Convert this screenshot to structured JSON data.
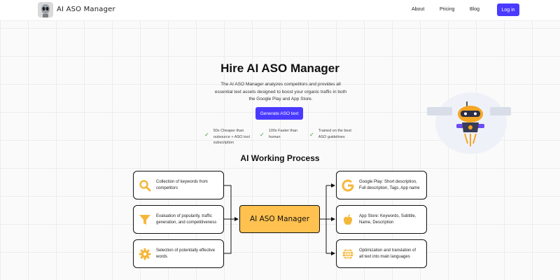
{
  "header": {
    "logo_text": "AI ASO Manager",
    "nav": [
      "About",
      "Pricing",
      "Blog"
    ],
    "login_label": "Log in"
  },
  "hero": {
    "title": "Hire AI ASO Manager",
    "description": "The AI ASO Manager analyzes competitors and provides all essential text assets designed to boost your organic traffic in both the Google Play and App Store.",
    "cta_label": "Generate ASO text",
    "features": [
      {
        "line1": "50x Cheaper than",
        "line2": "outsource + ASO tool",
        "line3": "subscription"
      },
      {
        "line1": "100x Faster than",
        "line2": "human",
        "line3": ""
      },
      {
        "line1": "Trained on the best",
        "line2": "ASO guidelines",
        "line3": ""
      }
    ]
  },
  "process": {
    "title": "AI Working Process",
    "center_label": "AI ASO Manager",
    "inputs": [
      {
        "icon": "search-icon",
        "line1": "Collection of keywords from",
        "line2": "competitors",
        "line3": ""
      },
      {
        "icon": "funnel-icon",
        "line1": "Evaluation of popularity, traffic",
        "line2": "generation, and competitiveness",
        "line3": ""
      },
      {
        "icon": "gear-icon",
        "line1": "Selection of potentially effective",
        "line2": "words",
        "line3": ""
      }
    ],
    "outputs": [
      {
        "icon": "google-icon",
        "line1": "Google Play: Short description,",
        "line2": "Full description, Tags, App name"
      },
      {
        "icon": "apple-icon",
        "line1": "App Store: Keywords, Subtitle,",
        "line2": "Name, Description"
      },
      {
        "icon": "globe-icon",
        "line1": "Optimization and translation of",
        "line2": "all text into main languages"
      }
    ]
  },
  "colors": {
    "accent": "#4a3aff",
    "highlight": "#ffc14f",
    "icon": "#f5b73a",
    "check": "#2e9e3e"
  }
}
